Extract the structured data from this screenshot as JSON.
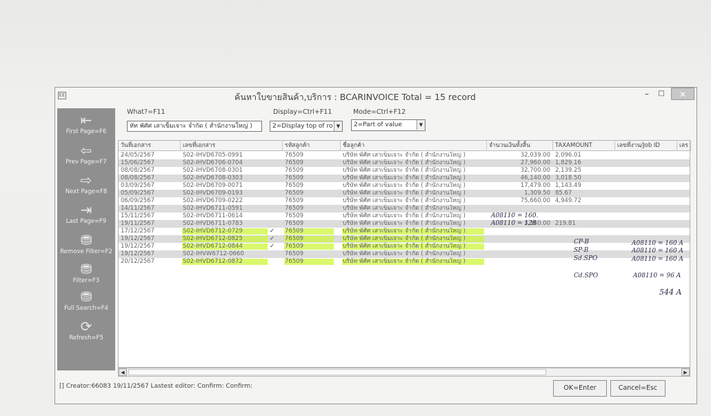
{
  "window": {
    "title": "ค้นหาใบขายสินค้า,บริการ : BCARINVOICE Total = 15 record",
    "minimize": "–",
    "maximize": "□",
    "close": "✕"
  },
  "sidebar": {
    "items": [
      {
        "label": "First Page=F6",
        "icon": "first-page-icon",
        "glyph": "⇤"
      },
      {
        "label": "Prev Page=F7",
        "icon": "prev-page-icon",
        "glyph": "⇦"
      },
      {
        "label": "Next Page=F8",
        "icon": "next-page-icon",
        "glyph": "⇨"
      },
      {
        "label": "Last Page=F9",
        "icon": "last-page-icon",
        "glyph": "⇥"
      },
      {
        "label": "Remove Filter=F2",
        "icon": "remove-filter-icon",
        "glyph": "⛃"
      },
      {
        "label": "Filter=F3",
        "icon": "filter-icon",
        "glyph": "⛃"
      },
      {
        "label": "Full Search=F4",
        "icon": "full-search-icon",
        "glyph": "⛃"
      },
      {
        "label": "Refresh=F5",
        "icon": "refresh-icon",
        "glyph": "⟳"
      }
    ]
  },
  "controls": {
    "what_label": "What?=F11",
    "what_value": "หัท พัศัศ เสาเข็มเจาะ จำกัด ( สำนักงานใหญ่ )",
    "display_label": "Display=Ctrl+F11",
    "display_value": "2=Display top of ro",
    "mode_label": "Mode=Ctrl+F12",
    "mode_value": "2=Part of value"
  },
  "table": {
    "columns": [
      "วันที่เอกสาร",
      "เลขที่เอกสาร",
      "รหัสลูกค้า",
      "ชื่อลูกค้า",
      "จำนวนเงินทั้งสิ้น",
      "TAXAMOUNT",
      "เลขที่งาน/Job ID",
      "เลร"
    ],
    "rows": [
      [
        "24/05/2567",
        "S02-IHVD6705-0991",
        "76509",
        "บริษัท พัศัศ เสาเข็มเจาะ จำกัด ( สำนักงานใหญ่ )",
        "32,039.00",
        "2,096.01"
      ],
      [
        "15/06/2567",
        "S02-IHVD6706-0704",
        "76509",
        "บริษัท พัศัศ เสาเข็มเจาะ จำกัด ( สำนักงานใหญ่ )",
        "27,960.00",
        "1,829.16"
      ],
      [
        "08/08/2567",
        "S02-IHVD6708-0301",
        "76509",
        "บริษัท พัศัศ เสาเข็มเจาะ จำกัด ( สำนักงานใหญ่ )",
        "32,700.00",
        "2,139.25"
      ],
      [
        "08/08/2567",
        "S02-IHVD6708-0303",
        "76509",
        "บริษัท พัศัศ เสาเข็มเจาะ จำกัด ( สำนักงานใหญ่ )",
        "46,140.00",
        "3,018.50"
      ],
      [
        "03/09/2567",
        "S02-IHVD6709-0071",
        "76509",
        "บริษัท พัศัศ เสาเข็มเจาะ จำกัด ( สำนักงานใหญ่ )",
        "17,479.00",
        "1,143.49"
      ],
      [
        "05/09/2567",
        "S02-IHVD6709-0193",
        "76509",
        "บริษัท พัศัศ เสาเข็มเจาะ จำกัด ( สำนักงานใหญ่ )",
        "1,309.50",
        "85.67"
      ],
      [
        "06/09/2567",
        "S02-IHVD6709-0222",
        "76509",
        "บริษัท พัศัศ เสาเข็มเจาะ จำกัด ( สำนักงานใหญ่ )",
        "75,660.00",
        "4,949.72"
      ],
      [
        "14/11/2567",
        "S02-IHVD6711-0591",
        "76509",
        "บริษัท พัศัศ เสาเข็มเจาะ จำกัด ( สำนักงานใหญ่ )",
        "",
        ""
      ],
      [
        "15/11/2567",
        "S02-IHVD6711-0614",
        "76509",
        "บริษัท พัศัศ เสาเข็มเจาะ จำกัด ( สำนักงานใหญ่ )",
        "",
        ""
      ],
      [
        "19/11/2567",
        "S02-IHVD6711-0783",
        "76509",
        "บริษัท พัศัศ เสาเข็มเจาะ จำกัด ( สำนักงานใหญ่ )",
        "3,360.00",
        "219.81"
      ],
      [
        "17/12/2567",
        "S02-IHVD6712-0729",
        "76509",
        "บริษัท พัศัศ เสาเข็มเจาะ จำกัด ( สำนักงานใหญ่ )",
        "",
        ""
      ],
      [
        "19/12/2567",
        "S02-IHVD6712-0825",
        "76509",
        "บริษัท พัศัศ เสาเข็มเจาะ จำกัด ( สำนักงานใหญ่ )",
        "",
        ""
      ],
      [
        "19/12/2567",
        "S02-IHVD6712-0844",
        "76509",
        "บริษัท พัศัศ เสาเข็มเจาะ จำกัด ( สำนักงานใหญ่ )",
        "",
        ""
      ],
      [
        "19/12/2567",
        "S02-IHVW6712-0660",
        "76509",
        "บริษัท พัศัศ เสาเข็มเจาะ จำกัด ( สำนักงานใหญ่ )",
        "",
        ""
      ],
      [
        "20/12/2567",
        "S02-IHVD6712-0872",
        "76509",
        "บริษัท พัศัศ เสาเข็มเจาะ จำกัด ( สำนักงานใหญ่ )",
        "",
        ""
      ]
    ]
  },
  "annotations": {
    "check": "✓",
    "n1": "A08110 = 160.",
    "n2": "A08110 = 128",
    "n3": "A08110 = 160 A",
    "n4": "A08110 = 160 A",
    "n5": "A08110 = 160 A",
    "n6": "A08110 = 96 A",
    "n7": "544 A",
    "c1": "CP-B",
    "c2": "SP-B",
    "c3": "Sd.SPO",
    "c4": "Cd.SPO"
  },
  "footer": {
    "status": "[] Creator:66083 19/11/2567 Lastest editor:   Confirm:  Confirm:",
    "ok": "OK=Enter",
    "cancel": "Cancel=Esc"
  },
  "colors": {
    "highlight": "#cdf53c",
    "sidebar": "#8f8f8f"
  }
}
